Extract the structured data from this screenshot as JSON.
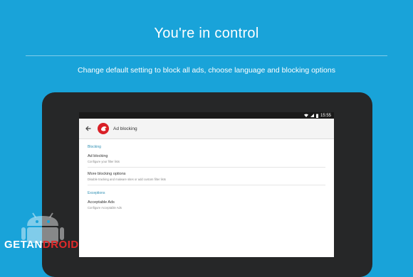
{
  "headline": "You're in control",
  "subtitle": "Change default setting to block all ads, choose language and blocking options",
  "device": {
    "status_bar": {
      "time": "15:55"
    },
    "app_bar": {
      "back_icon": "arrow-back-icon",
      "logo_icon": "adblock-logo-icon",
      "title": "Ad blocking"
    },
    "sections": [
      {
        "title": "Blocking",
        "items": [
          {
            "title": "Ad blocking",
            "subtitle": "Configure your filter lists"
          },
          {
            "title": "More blocking options",
            "subtitle": "Disable tracking and malware sites or add custom filter lists"
          }
        ]
      },
      {
        "title": "Exceptions",
        "items": [
          {
            "title": "Acceptable Ads",
            "subtitle": "Configure Acceptable Ads"
          }
        ]
      }
    ]
  },
  "watermark": {
    "text_prefix": "GETAN",
    "text_suffix": "DROID"
  },
  "colors": {
    "background": "#19a3d9",
    "accent": "#2f8fb3",
    "logo_red": "#d92027"
  }
}
